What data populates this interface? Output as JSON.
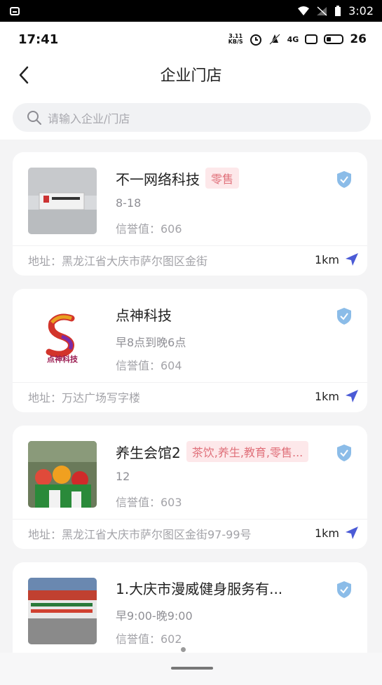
{
  "system": {
    "time": "3:02"
  },
  "status": {
    "time": "17:41",
    "speed_value": "3.11",
    "speed_unit": "KB/S",
    "signal": "4G",
    "battery": "26"
  },
  "nav": {
    "title": "企业门店"
  },
  "search": {
    "placeholder": "请输入企业/门店"
  },
  "stores": [
    {
      "name": "不一网络科技",
      "tag": "零售",
      "hours": "8-18",
      "credit": "信誉值：606",
      "address": "地址：黑龙江省大庆市萨尔图区金街",
      "distance": "1km",
      "thumb_text": "不一网络科技"
    },
    {
      "name": "点神科技",
      "tag": "",
      "hours": "早8点到晚6点",
      "credit": "信誉值：604",
      "address": "地址：万达广场写字楼",
      "distance": "1km",
      "thumb_text": "点神科技"
    },
    {
      "name": "养生会馆2",
      "tag": "茶饮,养生,教育,零售...",
      "hours": "12",
      "credit": "信誉值：603",
      "address": "地址：黑龙江省大庆市萨尔图区金街97-99号",
      "distance": "1km",
      "thumb_text": ""
    },
    {
      "name": "1.大庆市漫威健身服务有...",
      "tag": "",
      "hours": "早9:00-晚9:00",
      "credit": "信誉值：602",
      "address": "",
      "distance": "",
      "thumb_text": ""
    }
  ],
  "colors": {
    "tag_text": "#e0707a",
    "tag_bg": "#fde8ea",
    "shield": "#6fa8dc",
    "nav_arrow": "#4b5bd6"
  }
}
